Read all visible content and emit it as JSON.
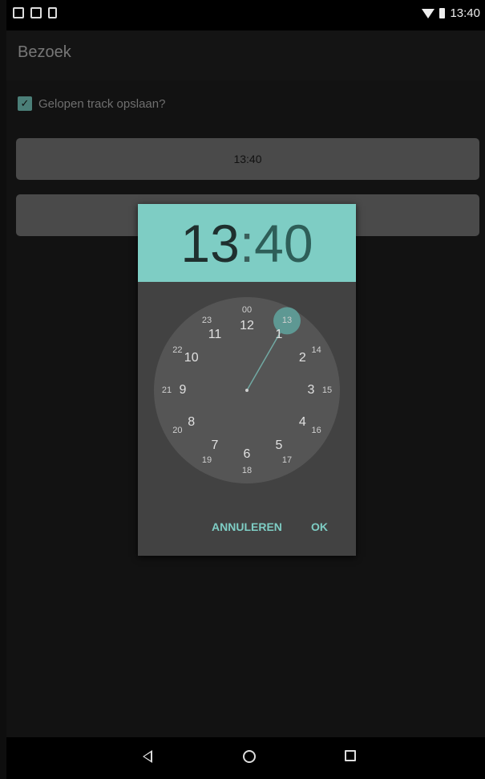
{
  "status_bar": {
    "time": "13:40",
    "icons": [
      "image-icon",
      "gallery-icon",
      "phone-icon",
      "wifi-icon",
      "battery-icon"
    ]
  },
  "app_bar": {
    "title": "Bezoek"
  },
  "form": {
    "checkbox_label": "Gelopen track opslaan?",
    "checkbox_checked": true,
    "button1_label": "13:40",
    "button2_label": ""
  },
  "time_picker": {
    "hour": "13",
    "separator": ":",
    "minute": "40",
    "selected_hour": "13",
    "outer_hours": [
      "12",
      "1",
      "2",
      "3",
      "4",
      "5",
      "6",
      "7",
      "8",
      "9",
      "10",
      "11"
    ],
    "inner_hours": [
      "00",
      "13",
      "14",
      "15",
      "16",
      "17",
      "18",
      "19",
      "20",
      "21",
      "22",
      "23"
    ],
    "cancel_label": "ANNULEREN",
    "ok_label": "OK"
  },
  "nav_bar": {
    "icons": [
      "back-icon",
      "home-icon",
      "recent-apps-icon"
    ]
  },
  "colors": {
    "accent": "#7ecdc4",
    "dialog": "#424242",
    "dial": "#555555",
    "button": "#4a4a4a"
  }
}
